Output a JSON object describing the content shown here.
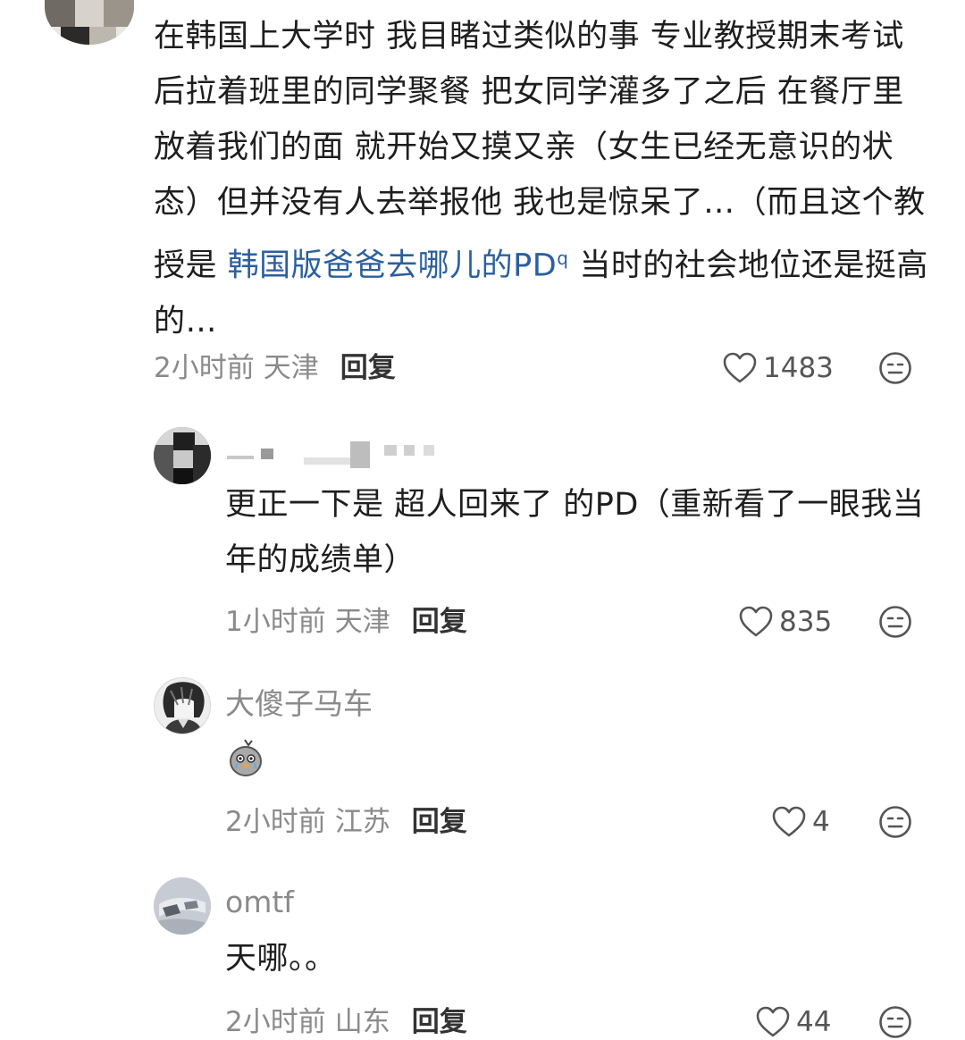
{
  "main_comment": {
    "text_part1": "在韩国上大学时 我目睹过类似的事 专业教授期末考试后拉着班里的同学聚餐 把女同学灌多了之后 在餐厅里放着我们的面 就开始又摸又亲（女生已经无意识的状态）但并没有人去举报他 我也是惊呆了…（而且这个教授是 ",
    "link_text": "韩国版爸爸去哪儿的PD",
    "link_icon": "search-icon",
    "text_part2": "当时的社会地位还是挺高的…",
    "time": "2小时前",
    "location": "天津",
    "reply_label": "回复",
    "likes": "1483"
  },
  "replies": [
    {
      "username": "",
      "text": "更正一下是 超人回来了 的PD（重新看了一眼我当年的成绩单）",
      "time": "1小时前",
      "location": "天津",
      "reply_label": "回复",
      "likes": "835"
    },
    {
      "username": "大傻子马车",
      "text": "",
      "sticker_icon": "crying-chick-sticker-icon",
      "time": "2小时前",
      "location": "江苏",
      "reply_label": "回复",
      "likes": "4"
    },
    {
      "username": "omtf",
      "text": "天哪。。",
      "time": "2小时前",
      "location": "山东",
      "reply_label": "回复",
      "likes": "44"
    }
  ],
  "colors": {
    "link": "#2b5f9e",
    "meta": "#8a8a8a",
    "text": "#1e1e1e"
  }
}
